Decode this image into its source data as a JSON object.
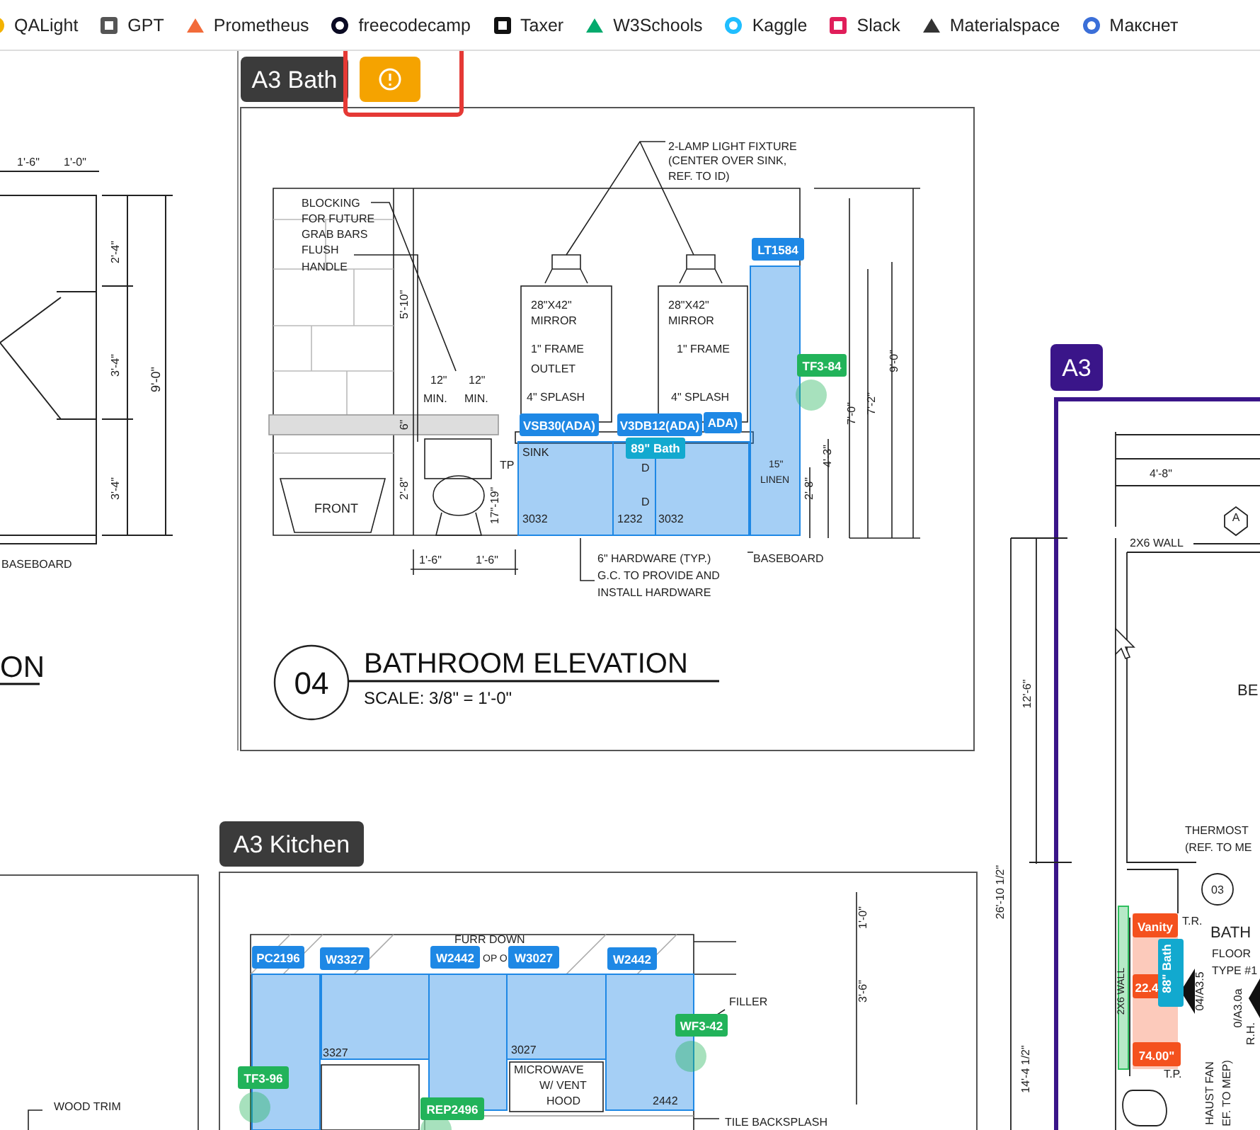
{
  "bookmarks": [
    {
      "label": "QALight"
    },
    {
      "label": "GPT"
    },
    {
      "label": "Prometheus"
    },
    {
      "label": "freecodecamp"
    },
    {
      "label": "Taxer"
    },
    {
      "label": "W3Schools"
    },
    {
      "label": "Kaggle"
    },
    {
      "label": "Slack"
    },
    {
      "label": "Materialspace"
    },
    {
      "label": "Макснет"
    }
  ],
  "sheets": [
    {
      "kind": "partial-elevation",
      "notes": [
        "1'-6\"",
        "1'-0\"",
        "2'-4\"",
        "3'-4\"",
        "3'-4\"",
        "9'-0\"",
        "BASEBOARD"
      ],
      "title_fragment": "ON"
    },
    {
      "kind": "bath-elevation",
      "title": "A3 Bath",
      "warning": true,
      "warning_highlighted": true,
      "notes": [
        "2-LAMP LIGHT FIXTURE",
        "(CENTER OVER SINK,",
        "REF. TO ID)",
        "BLOCKING",
        "FOR FUTURE",
        "GRAB BARS",
        "FLUSH",
        "HANDLE",
        "5'-10\"",
        "12\"",
        "12\"",
        "MIN.",
        "MIN.",
        "6\"",
        "2'-8\"",
        "FRONT",
        "TP",
        "17\"-19\"",
        "1'-6\"",
        "1'-6\"",
        "28\"X42\"",
        "MIRROR",
        "1\" FRAME",
        "OUTLET",
        "4\" SPLASH",
        "28\"X42\"",
        "MIRROR",
        "1\" FRAME",
        "4\" SPLASH",
        "SINK",
        "D",
        "D",
        "3032",
        "1232",
        "3032",
        "15\"",
        "LINEN",
        "4'-3\"",
        "2'-8\"",
        "7'-0\"",
        "7'-2\"",
        "9'-0\"",
        "6\" HARDWARE (TYP.)",
        "G.C. TO PROVIDE AND",
        "INSTALL HARDWARE",
        "BASEBOARD"
      ],
      "detail_number": "04",
      "drawing_title": "BATHROOM ELEVATION",
      "scale": "SCALE: 3/8\" = 1'-0\"",
      "tags": [
        {
          "label": "LT1584",
          "color": "#1e88e5"
        },
        {
          "label": "TF3-84",
          "color": "#22b35a"
        },
        {
          "label": "VSB30(ADA)",
          "color": "#1e88e5"
        },
        {
          "label": "V3DB12(ADA)",
          "color": "#1e88e5"
        },
        {
          "label": "ADA)",
          "color": "#1e88e5"
        },
        {
          "label": "89\" Bath",
          "color": "#12a9cf"
        }
      ]
    },
    {
      "kind": "kitchen-elevation",
      "title": "A3 Kitchen",
      "notes": [
        "FURR DOWN",
        "OP O",
        "3327",
        "3027",
        "MICROWAVE",
        "W/ VENT",
        "HOOD",
        "2442",
        "FILLER",
        "1'-0\"",
        "3'-6\"",
        "WOOD TRIM",
        "TILE BACKSPLASH"
      ],
      "tags": [
        {
          "label": "PC2196",
          "color": "#1e88e5"
        },
        {
          "label": "W3327",
          "color": "#1e88e5"
        },
        {
          "label": "W2442",
          "color": "#1e88e5"
        },
        {
          "label": "W3027",
          "color": "#1e88e5"
        },
        {
          "label": "W2442",
          "color": "#1e88e5"
        },
        {
          "label": "WF3-42",
          "color": "#22b35a"
        },
        {
          "label": "TF3-96",
          "color": "#22b35a"
        },
        {
          "label": "REP2496",
          "color": "#22b35a"
        }
      ]
    },
    {
      "kind": "plan",
      "title": "A3",
      "notes": [
        "4'-8\"",
        "A",
        "2X6 WALL",
        "BE",
        "12'-6\"",
        "26'-10 1/2\"",
        "14'-4 1/2\"",
        "THERMOST",
        "(REF. TO ME",
        "03",
        "T.R.",
        "BATH",
        "FLOOR",
        "TYPE #1",
        "2X6 WALL",
        "04/A3.5",
        "0/A3.0a",
        "R.H.",
        "T.P.",
        "HAUST FAN",
        "EF. TO MEP)"
      ],
      "tags": [
        {
          "label": "Vanity",
          "color": "#f4511e"
        },
        {
          "label": "22.4",
          "color": "#f4511e"
        },
        {
          "label": "74.00\"",
          "color": "#f4511e"
        },
        {
          "label": "88\" Bath",
          "color": "#12a9cf"
        }
      ]
    }
  ]
}
